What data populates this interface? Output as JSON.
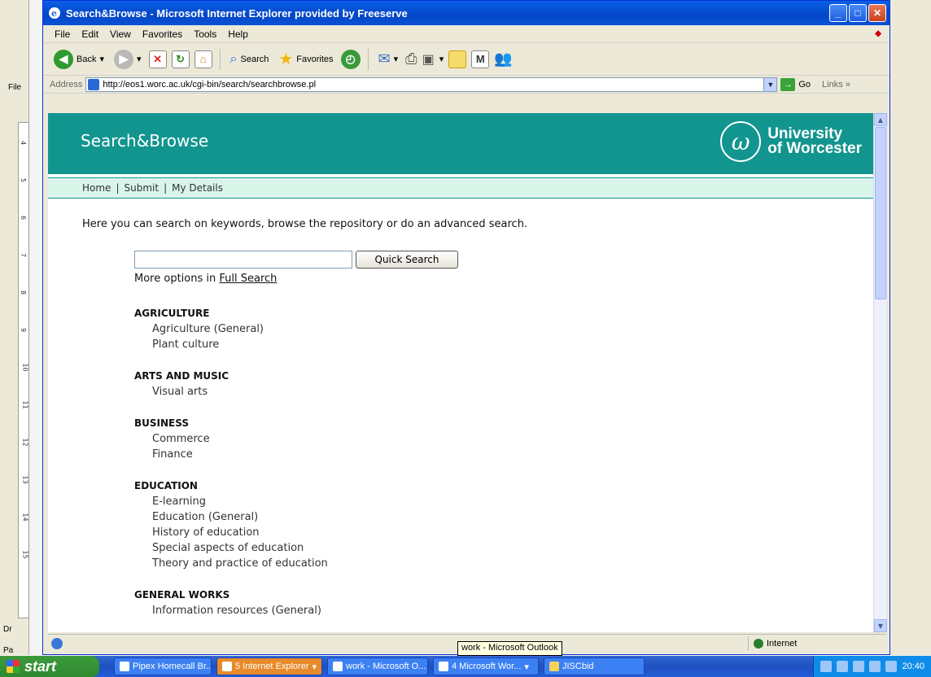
{
  "window": {
    "title": "Search&Browse - Microsoft Internet Explorer provided by Freeserve",
    "menu": [
      "File",
      "Edit",
      "View",
      "Favorites",
      "Tools",
      "Help"
    ]
  },
  "toolbar": {
    "back": "Back",
    "search": "Search",
    "favorites": "Favorites"
  },
  "address": {
    "label": "Address",
    "url": "http://eos1.worc.ac.uk/cgi-bin/search/searchbrowse.pl",
    "go": "Go",
    "links": "Links"
  },
  "site": {
    "title": "Search&Browse",
    "logo_line1": "University",
    "logo_line2": "of Worcester",
    "nav": [
      "Home",
      "Submit",
      "My Details"
    ],
    "intro": "Here you can search on keywords, browse the repository or do an advanced search.",
    "quick_search_button": "Quick Search",
    "more_options_prefix": "More options in",
    "full_search_link": "Full Search"
  },
  "subjects": [
    {
      "heading": "AGRICULTURE",
      "items": [
        "Agriculture (General)",
        "Plant culture"
      ]
    },
    {
      "heading": "ARTS AND MUSIC",
      "items": [
        "Visual arts"
      ]
    },
    {
      "heading": "BUSINESS",
      "items": [
        "Commerce",
        "Finance"
      ]
    },
    {
      "heading": "EDUCATION",
      "items": [
        "E-learning",
        "Education (General)",
        "History of education",
        "Special aspects of education",
        "Theory and practice of education"
      ]
    },
    {
      "heading": "GENERAL WORKS",
      "items": [
        "Information resources (General)"
      ]
    }
  ],
  "status": {
    "zone": "Internet",
    "tooltip": "work - Microsoft Outlook"
  },
  "taskbar": {
    "start": "start",
    "tasks": [
      "Pipex Homecall Br...",
      "5 Internet Explorer",
      "work - Microsoft O...",
      "4 Microsoft Wor...",
      "JISCbid"
    ],
    "clock": "20:40"
  },
  "word": {
    "ruler_ticks": [
      "4",
      "5",
      "6",
      "7",
      "8",
      "9",
      "10",
      "11",
      "12",
      "13",
      "14",
      "15"
    ],
    "file_label": "File",
    "draw_label": "Dr",
    "page_label": "Pa"
  },
  "colors": {
    "header_teal": "#12958f",
    "nav_mint": "#d9f5ea"
  }
}
